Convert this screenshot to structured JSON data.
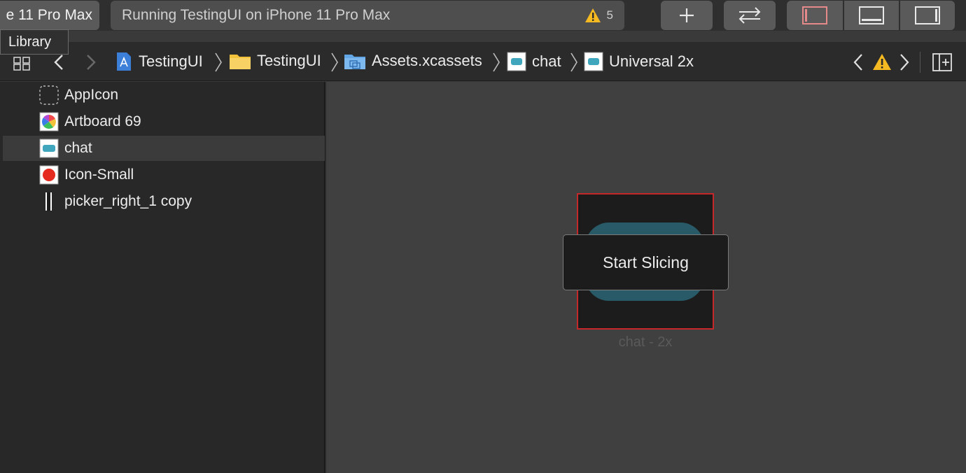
{
  "toolbar": {
    "scheme": "e 11 Pro Max",
    "status": "Running TestingUI on iPhone 11 Pro Max",
    "warning_count": "5",
    "tooltip": "Library",
    "add_icon": "plus-icon",
    "swap_icon": "arrows-swap-icon",
    "navigator_toggle_color": "#e58a8a"
  },
  "jumpbar": {
    "crumbs": [
      {
        "label": "TestingUI",
        "icon": "project-icon"
      },
      {
        "label": "TestingUI",
        "icon": "folder-icon"
      },
      {
        "label": "Assets.xcassets",
        "icon": "asset-catalog-icon"
      },
      {
        "label": "chat",
        "icon": "image-set-icon"
      },
      {
        "label": "Universal 2x",
        "icon": "image-set-icon"
      }
    ]
  },
  "navigator": {
    "items": [
      {
        "label": "AppIcon",
        "icon": "appicon-placeholder-icon"
      },
      {
        "label": "Artboard 69",
        "icon": "color-wheel-icon"
      },
      {
        "label": "chat",
        "icon": "chat-image-icon",
        "selected": true
      },
      {
        "label": "Icon-Small",
        "icon": "red-dot-icon"
      },
      {
        "label": "picker_right_1 copy",
        "icon": "picker-image-icon"
      }
    ]
  },
  "editor": {
    "caption": "chat - 2x",
    "slice_button": "Start Slicing",
    "frame_color": "#c4282b",
    "pill_color": "#285a68"
  }
}
